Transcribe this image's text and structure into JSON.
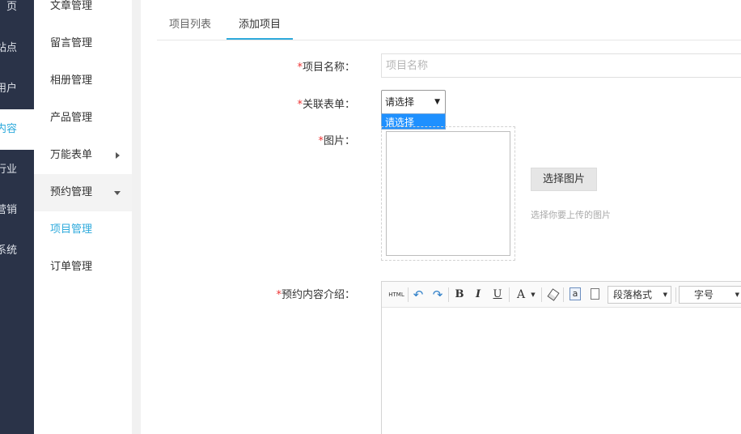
{
  "main_nav": {
    "items": [
      {
        "label": "页",
        "active": false
      },
      {
        "label": "站点",
        "active": false
      },
      {
        "label": "用户",
        "active": false
      },
      {
        "label": "内容",
        "active": true
      },
      {
        "label": "行业",
        "active": false
      },
      {
        "label": "营销",
        "active": false
      },
      {
        "label": "系统",
        "active": false
      }
    ]
  },
  "sub_nav": {
    "items": [
      {
        "label": "文章管理"
      },
      {
        "label": "留言管理"
      },
      {
        "label": "相册管理"
      },
      {
        "label": "产品管理"
      },
      {
        "label": "万能表单"
      },
      {
        "label": "预约管理"
      },
      {
        "label": "项目管理"
      },
      {
        "label": "订单管理"
      }
    ]
  },
  "tabs": [
    {
      "label": "项目列表"
    },
    {
      "label": "添加项目"
    }
  ],
  "form": {
    "project_name": {
      "required_mark": "*",
      "label": "项目名称：",
      "placeholder": "项目名称",
      "value": ""
    },
    "related_form": {
      "required_mark": "*",
      "label": "关联表单：",
      "selected": "请选择",
      "options": [
        "请选择"
      ]
    },
    "image": {
      "required_mark": "*",
      "label": "图片：",
      "button": "选择图片",
      "hint": "选择你要上传的图片"
    },
    "intro": {
      "required_mark": "*",
      "label": "预约内容介绍："
    }
  },
  "editor_toolbar": {
    "html_label": "HTML",
    "bold": "B",
    "italic": "I",
    "underline": "U",
    "font_color": "A",
    "at_label": "a",
    "paragraph_format": "段落格式",
    "font_size": "字号"
  },
  "icons": {
    "sub_nav_expand": "chevron-right-icon",
    "sub_nav_collapse": "chevron-down-icon",
    "undo": "undo-icon",
    "redo": "redo-icon",
    "eraser": "eraser-icon",
    "doc": "document-icon"
  },
  "colors": {
    "accent": "#2eaadc",
    "main_nav_bg": "#2a3348",
    "required": "#e33333",
    "dropdown_highlight": "#1e90ff"
  }
}
